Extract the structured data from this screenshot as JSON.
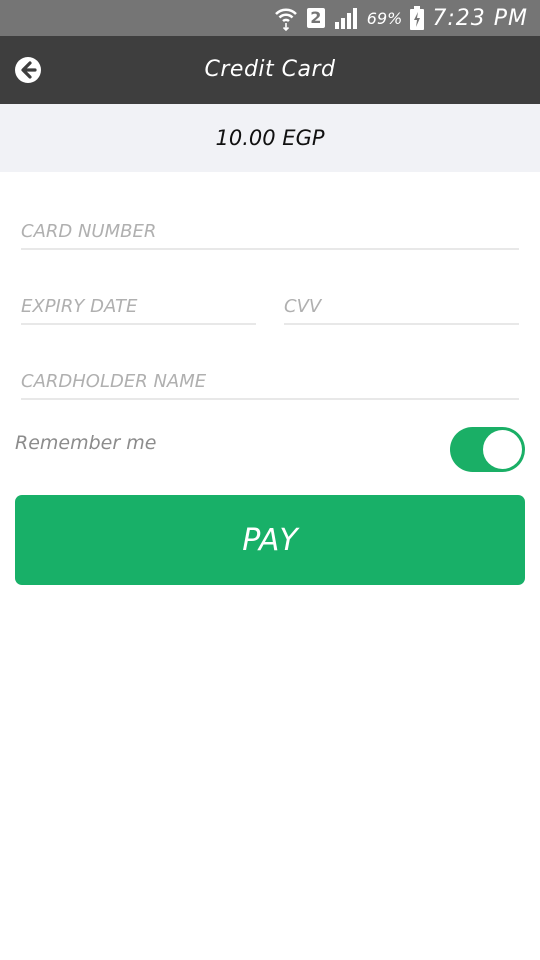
{
  "status_bar": {
    "sim_slot": "2",
    "battery_percent": "69%",
    "time": "7:23 PM",
    "icons": [
      "wifi-icon",
      "sim-icon",
      "signal-icon",
      "battery-charging-icon"
    ]
  },
  "header": {
    "title": "Credit Card",
    "back_icon": "back-arrow-icon"
  },
  "amount": {
    "text": "10.00 EGP"
  },
  "form": {
    "card_number_placeholder": "CARD NUMBER",
    "expiry_placeholder": "EXPIRY DATE",
    "cvv_placeholder": "CVV",
    "cardholder_placeholder": "CARDHOLDER NAME",
    "remember_label": "Remember me",
    "remember_enabled": true,
    "pay_label": "PAY"
  },
  "colors": {
    "status_bar": "#757575",
    "header": "#3e3e3e",
    "amount_band": "#f1f2f6",
    "accent_green": "#18b068"
  }
}
